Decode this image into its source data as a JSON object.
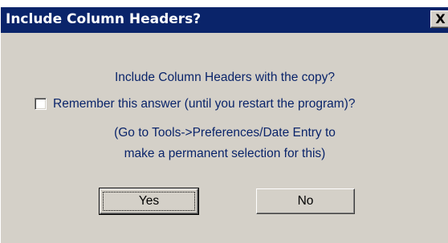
{
  "dialog": {
    "title": "Include Column Headers?",
    "close_label": "X",
    "question": "Include Column Headers with the copy?",
    "remember_label": "Remember this answer (until you restart the program)?",
    "remember_checked": false,
    "hint_line1": "(Go to Tools->Preferences/Date Entry to",
    "hint_line2": "make a permanent selection for this)",
    "yes_label": "Yes",
    "no_label": "No"
  },
  "colors": {
    "titlebar": "#0a246a",
    "dialog_bg": "#d4d0c8",
    "message_text": "#0a246a"
  },
  "icons": {
    "close": "close-icon"
  }
}
